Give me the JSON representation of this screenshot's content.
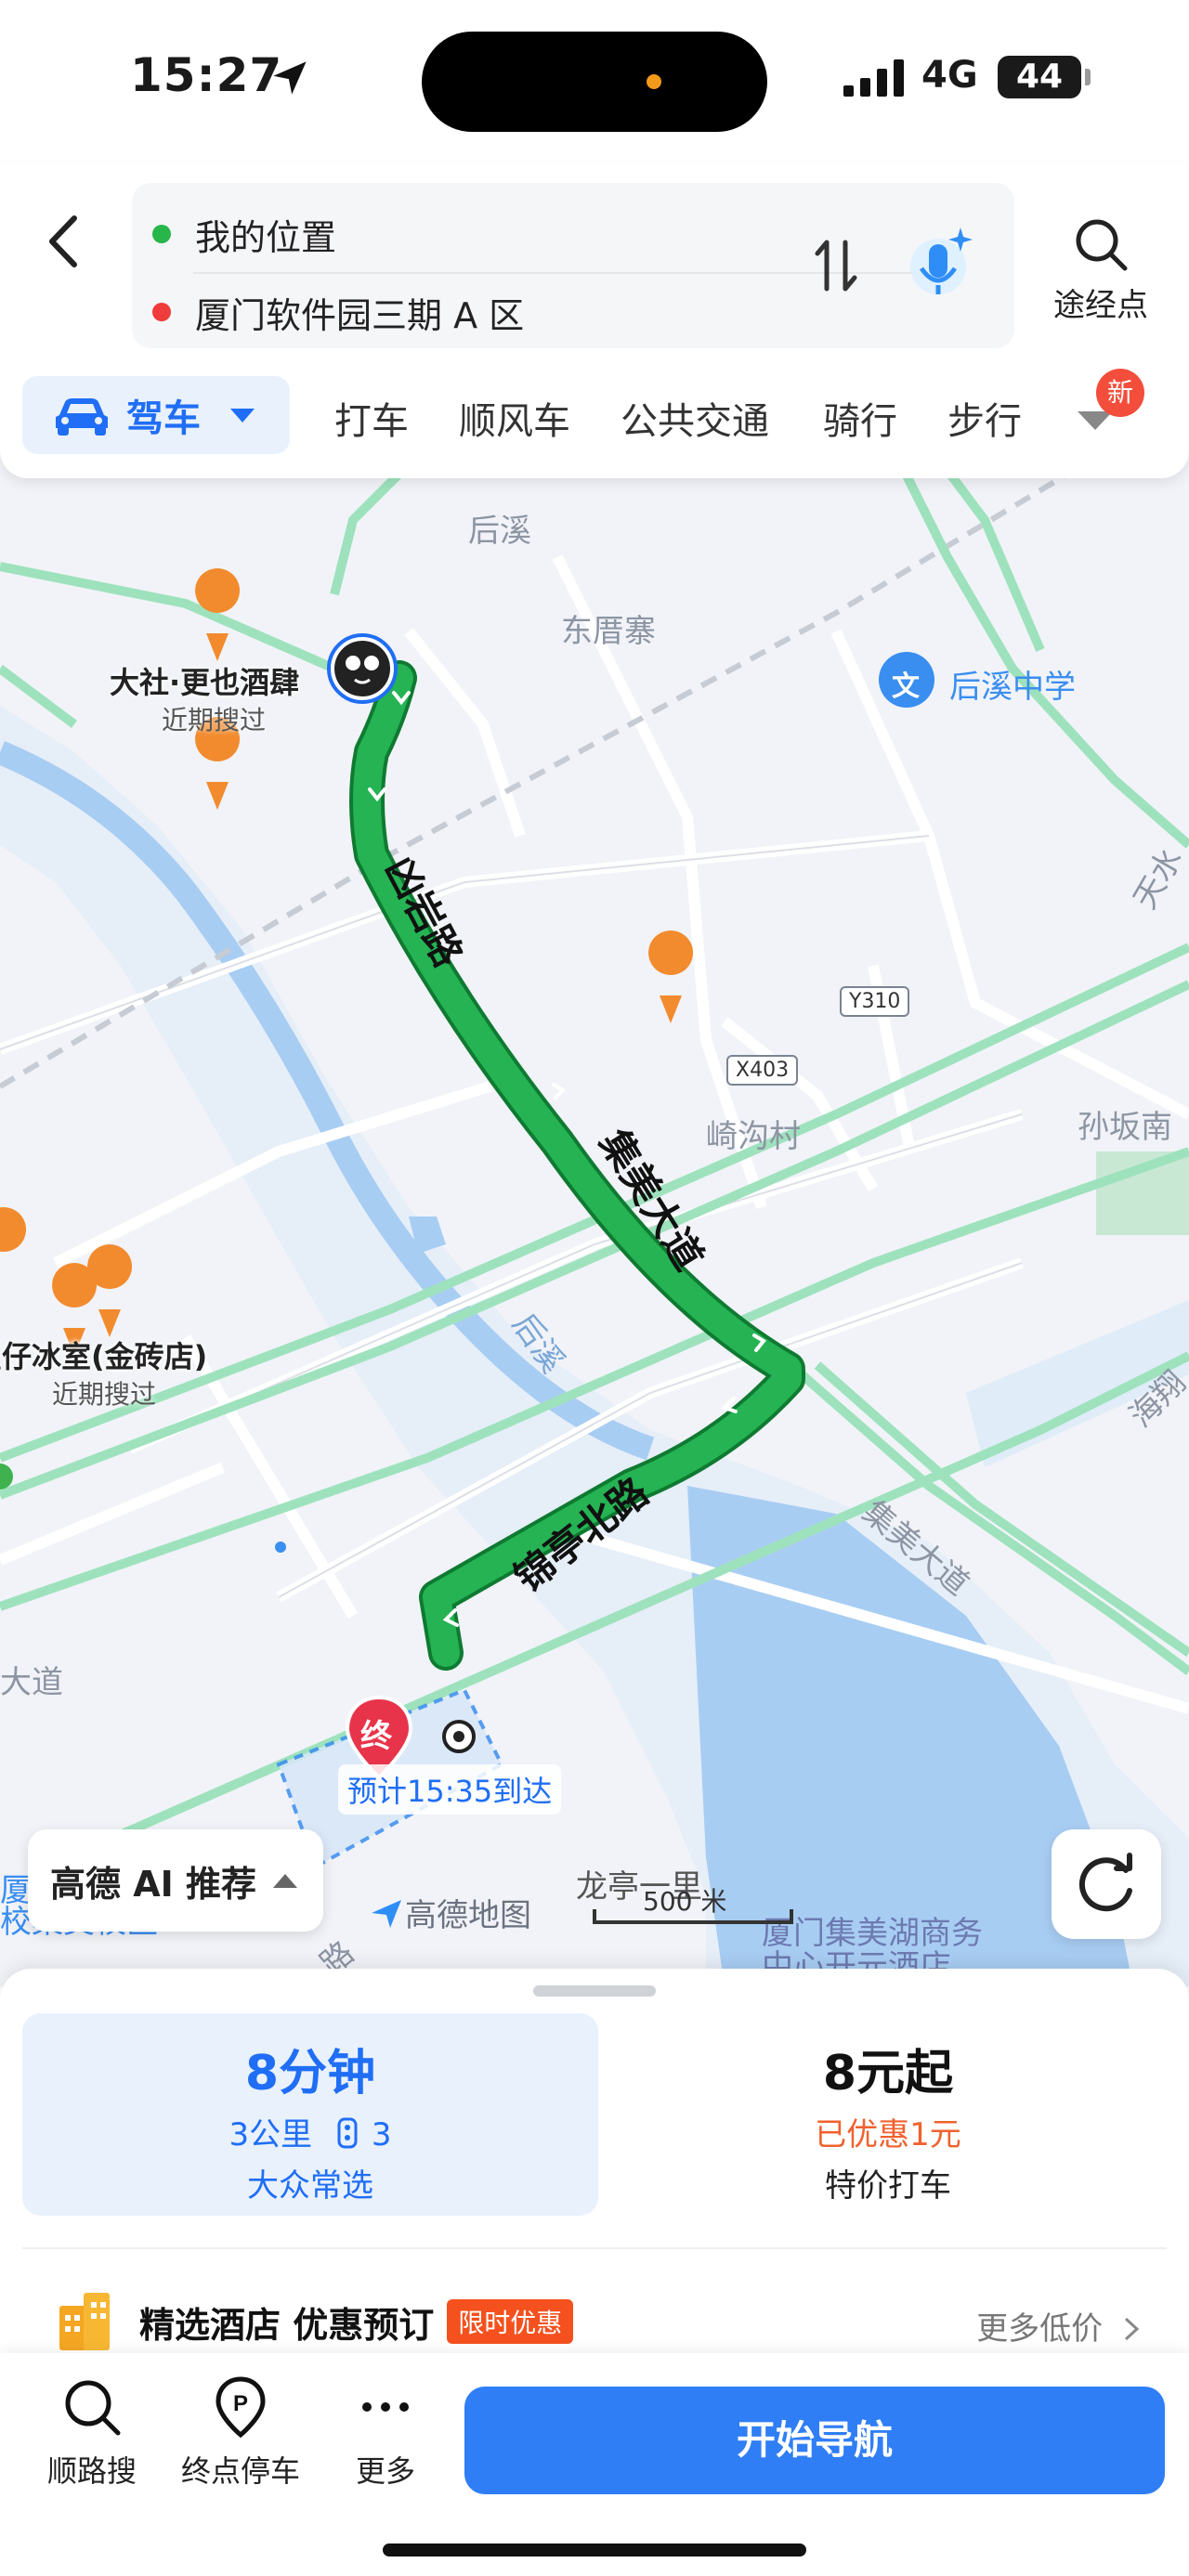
{
  "status": {
    "time": "15:27",
    "network": "4G",
    "battery": "44"
  },
  "route": {
    "start": "我的位置",
    "end": "厦门软件园三期 A 区",
    "waypoint_label": "途经点"
  },
  "modes": {
    "active": "驾车",
    "items": [
      "打车",
      "顺风车",
      "公共交通",
      "骑行",
      "步行"
    ],
    "new_badge": "新"
  },
  "map": {
    "labels": {
      "houxi": "后溪",
      "dongcuozhai": "东厝寨",
      "houxi_school": "后溪中学",
      "wen": "文",
      "qigoucun": "崎沟村",
      "sunbannan": "孙坂南",
      "houxi_river": "后溪",
      "tianshui": "天水",
      "haixiang": "海翔",
      "jimei_avenue_side": "集美大道",
      "road_left": "大道",
      "longting": "龙亭一里",
      "xia": "厦",
      "xiaojimei": "校集美校区",
      "jimei_lake": "厦门集美湖商务",
      "hotel_part": "中心开元酒店",
      "lu": "路"
    },
    "tags": {
      "y310": "Y310",
      "x403": "X403"
    },
    "pois": [
      {
        "name": "大社·更也酒肆",
        "sub": "近期搜过"
      },
      {
        "name": "星仔冰室(金砖店)",
        "sub": "近期搜过"
      }
    ],
    "route_roads": {
      "first": "凶岩路",
      "second": "集美大道",
      "third": "锦亭北路"
    },
    "end_pin": "终",
    "eta": "预计15:35到达",
    "ai_button": "高德 AI 推荐",
    "brand": "高德地图",
    "scale": "500 米"
  },
  "plan": {
    "duration": "8分钟",
    "distance": "3公里",
    "lights": "3",
    "tag": "大众常选"
  },
  "taxi": {
    "price": "8元起",
    "discount": "已优惠1元",
    "type": "特价打车"
  },
  "hotel": {
    "title": "精选酒店 优惠预订",
    "badge": "限时优惠",
    "more": "更多低价"
  },
  "toolbar": {
    "search_along": "顺路搜",
    "parking": "终点停车",
    "more": "更多",
    "start_nav": "开始导航"
  },
  "colors": {
    "accent": "#1f6ef5",
    "route": "#19a84b",
    "button": "#2f7ef6",
    "end_pin": "#e8344a"
  }
}
